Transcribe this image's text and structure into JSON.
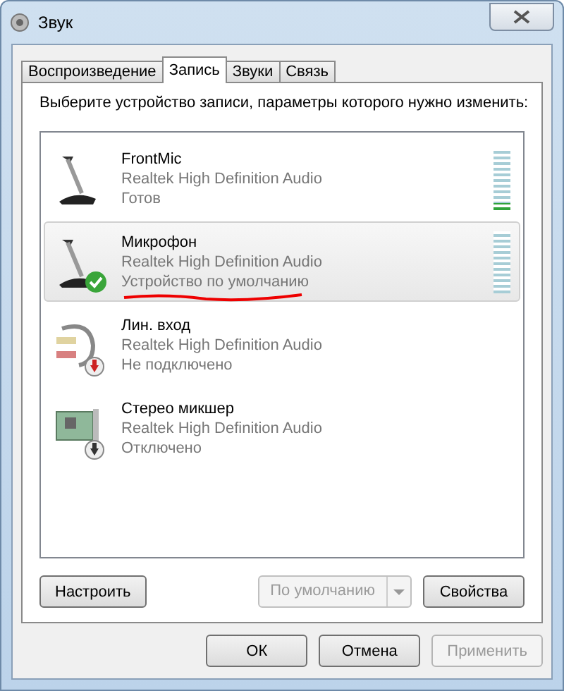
{
  "window": {
    "title": "Звук"
  },
  "tabs": [
    {
      "label": "Воспроизведение",
      "selected": false
    },
    {
      "label": "Запись",
      "selected": true
    },
    {
      "label": "Звуки",
      "selected": false
    },
    {
      "label": "Связь",
      "selected": false
    }
  ],
  "instruction": "Выберите устройство записи, параметры которого нужно изменить:",
  "devices": [
    {
      "name": "FrontMic",
      "driver": "Realtek High Definition Audio",
      "status": "Готов",
      "kind": "mic",
      "default_device": false,
      "unplugged": false,
      "disabled": false,
      "selected": false,
      "level": 0.1
    },
    {
      "name": "Микрофон",
      "driver": "Realtek High Definition Audio",
      "status": "Устройство по умолчанию",
      "kind": "mic",
      "default_device": true,
      "unplugged": false,
      "disabled": false,
      "selected": true,
      "level": 0
    },
    {
      "name": "Лин. вход",
      "driver": "Realtek High Definition Audio",
      "status": "Не подключено",
      "kind": "line",
      "default_device": false,
      "unplugged": true,
      "disabled": false,
      "selected": false
    },
    {
      "name": "Стерео микшер",
      "driver": "Realtek High Definition Audio",
      "status": "Отключено",
      "kind": "card",
      "default_device": false,
      "unplugged": false,
      "disabled": true,
      "selected": false
    }
  ],
  "panel_buttons": {
    "configure": "Настроить",
    "default_split": {
      "label": "По умолчанию",
      "disabled": true
    },
    "properties": "Свойства"
  },
  "dialog_buttons": [
    {
      "label": "ОК",
      "disabled": false
    },
    {
      "label": "Отмена",
      "disabled": false
    },
    {
      "label": "Применить",
      "disabled": true
    }
  ]
}
